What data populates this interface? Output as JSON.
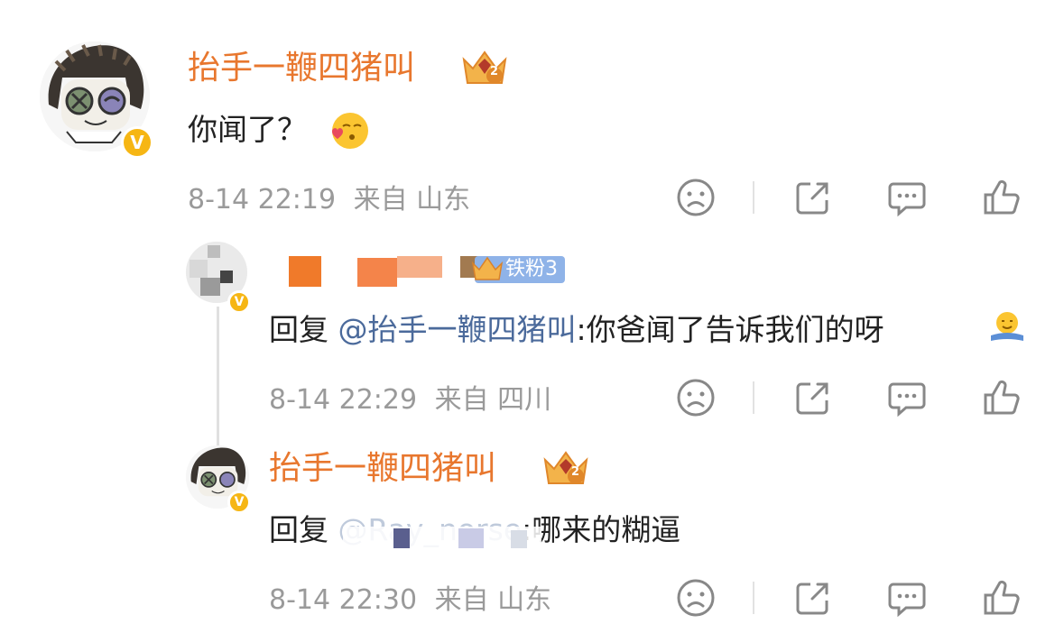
{
  "comments": [
    {
      "username": "抬手一鞭四猪叫",
      "content": "你闻了？",
      "emoji": "kiss-emoji",
      "time": "8-14 22:19",
      "location": "来自 山东"
    },
    {
      "username": "",
      "fan_badge": "铁粉3",
      "reply_prefix": "回复 ",
      "mention": "@抬手一鞭四猪叫",
      "content": ":你爸闻了告诉我们的呀",
      "emoji": "hug-emoji",
      "time": "8-14 22:29",
      "location": "来自 四川"
    },
    {
      "username": "抬手一鞭四猪叫",
      "reply_prefix": "回复 ",
      "mention": "@Ray_norse",
      "content": ":哪来的糊逼",
      "time": "8-14 22:30",
      "location": "来自 山东"
    }
  ],
  "icons": {
    "verified": "V",
    "crown_level": "2"
  },
  "colors": {
    "username": "#e8772e",
    "mention": "#4b6a9b",
    "meta": "#9a9a9a",
    "verified": "#f6b614"
  }
}
